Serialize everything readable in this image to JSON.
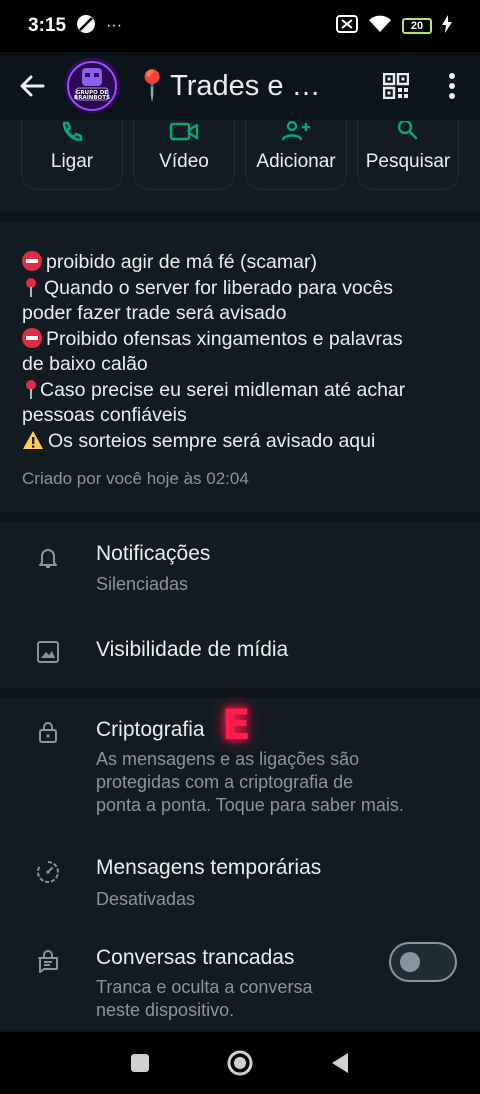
{
  "status_bar": {
    "time": "3:15",
    "dots": "···",
    "battery": "20"
  },
  "header": {
    "title": "📍Trades e pvp",
    "avatar_text": "GRUPO DE BRAINBOTS"
  },
  "actions": [
    {
      "label": "Ligar",
      "icon": "phone-icon"
    },
    {
      "label": "Vídeo",
      "icon": "video-icon"
    },
    {
      "label": "Adicionar",
      "icon": "add-person-icon"
    },
    {
      "label": "Pesquisar",
      "icon": "search-icon"
    }
  ],
  "description": {
    "lines": [
      "proibido agir de má fé (scamar)",
      "Quando o server for liberado para vocês",
      "poder fazer trade será avisado",
      "Proibido ofensas xingamentos e palavras",
      "de baixo calão",
      "Caso precise eu serei midleman até achar",
      "pessoas confiáveis",
      "Os sorteios sempre será avisado aqui"
    ],
    "meta": "Criado por você hoje às 02:04"
  },
  "settings": {
    "notifications": {
      "title": "Notificações",
      "subtitle": "Silenciadas"
    },
    "media_visibility": {
      "title": "Visibilidade de mídia"
    },
    "encryption": {
      "title": "Criptografia",
      "subtitle_lines": [
        "As mensagens e as ligações são",
        "protegidas com a criptografia de",
        "ponta a ponta. Toque para saber mais."
      ]
    },
    "temporary_messages": {
      "title": "Mensagens temporárias",
      "subtitle": "Desativadas"
    },
    "locked_chats": {
      "title": "Conversas trancadas",
      "subtitle_lines": [
        "Tranca e oculta a conversa",
        "neste dispositivo."
      ],
      "enabled": false
    }
  },
  "overlay_letter": "E",
  "colors": {
    "accent": "#00a884",
    "background": "#0b141a",
    "surface": "#111b21",
    "secondary_text": "#8696a0"
  }
}
